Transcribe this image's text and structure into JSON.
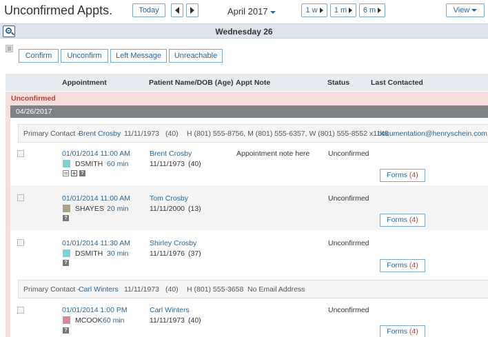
{
  "header": {
    "title": "Unconfirmed Appts.",
    "today_label": "Today",
    "month_label": "April 2017",
    "range_1w": "1 w",
    "range_1m": "1 m",
    "range_6m": "6 m",
    "view_label": "View"
  },
  "day": {
    "title": "Wednesday 26"
  },
  "actions": {
    "confirm": "Confirm",
    "unconfirm": "Unconfirm",
    "left_message": "Left Message",
    "unreachable": "Unreachable"
  },
  "columns": {
    "appointment": "Appointment",
    "patient": "Patient Name/DOB (Age)",
    "note": "Appt Note",
    "status": "Status",
    "last_contacted": "Last Contacted"
  },
  "group": {
    "label": "Unconfirmed",
    "date": "04/26/2017"
  },
  "contacts": [
    {
      "prefix": "Primary Contact -",
      "name": "Brent Crosby",
      "dob": "11/11/1973",
      "age": "(40)",
      "phones": "H (801) 555-8756, M (801) 555-6357, W (801) 555-8552 x1145",
      "email": "documentation@henryschein.com"
    },
    {
      "prefix": "Primary Contact -",
      "name": "Carl Winters",
      "dob": "11/11/1973",
      "age": "(40)",
      "phones": "H (801) 555-3658",
      "email": "No Email Address"
    }
  ],
  "appointments": [
    {
      "datetime": "01/01/2014 11:00 AM",
      "provider": "DSMITH",
      "duration": "60 min",
      "color": "#7fd1d6",
      "patient": "Brent Crosby",
      "dob": "11/11/1973",
      "age": "(40)",
      "note": "Appointment note here",
      "status": "Unconfirmed",
      "forms_label": "Forms",
      "forms_count": "(4)"
    },
    {
      "datetime": "01/01/2014 11:00 AM",
      "provider": "SHAYES",
      "duration": "20 min",
      "color": "#a8a184",
      "patient": "Tom Crosby",
      "dob": "11/11/2000",
      "age": "(13)",
      "note": "",
      "status": "Unconfirmed",
      "forms_label": "Forms",
      "forms_count": "(4)"
    },
    {
      "datetime": "01/01/2014 11:30 AM",
      "provider": "DSMITH",
      "duration": "30 min",
      "color": "#7fd1d6",
      "patient": "Shirley Crosby",
      "dob": "11/11/1976",
      "age": "(37)",
      "note": "",
      "status": "Unconfirmed",
      "forms_label": "Forms",
      "forms_count": "(4)"
    },
    {
      "datetime": "01/01/2014 1:00 PM",
      "provider": "MCOOK",
      "duration": "60 min",
      "color": "#d9879b",
      "patient": "Carl Winters",
      "dob": "11/11/1973",
      "age": "(40)",
      "note": "",
      "status": "Unconfirmed",
      "forms_label": "Forms",
      "forms_count": "(4)"
    }
  ]
}
